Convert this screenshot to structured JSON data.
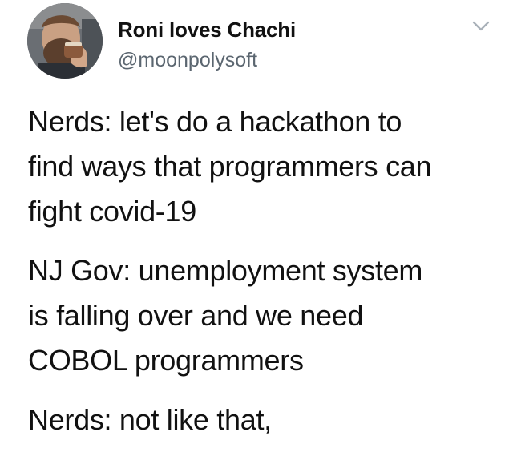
{
  "author": {
    "display_name": "Roni loves Chachi",
    "handle": "@moonpolysoft",
    "avatar_icon": "user-avatar-photo"
  },
  "menu": {
    "icon": "chevron-down-icon",
    "color": "#a8b0b8"
  },
  "tweet": {
    "paragraphs": [
      {
        "lines": [
          "Nerds: let's do a hackathon to",
          "find ways that programmers can",
          "fight covid-19"
        ]
      },
      {
        "lines": [
          "NJ Gov: unemployment system",
          "is falling over and we need",
          "COBOL programmers"
        ]
      },
      {
        "lines": [
          "Nerds: not like that,"
        ]
      }
    ]
  }
}
